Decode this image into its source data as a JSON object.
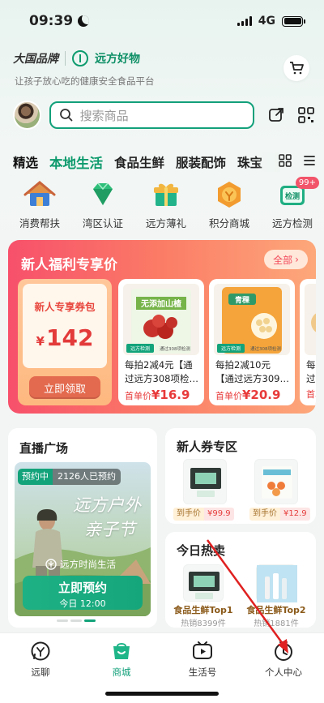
{
  "status_bar": {
    "time": "09:39",
    "network": "4G"
  },
  "header": {
    "brand_logo_text": "大国品牌",
    "brand_name": "远方好物",
    "slogan": "让孩子放心吃的健康安全食品平台"
  },
  "search": {
    "placeholder": "搜索商品"
  },
  "category_tabs": [
    "精选",
    "本地生活",
    "食品生鲜",
    "服装配饰",
    "珠宝"
  ],
  "active_tab": "本地生活",
  "quick_entries": [
    {
      "label": "消费帮扶",
      "icon": "house-icon"
    },
    {
      "label": "湾区认证",
      "icon": "gem-icon"
    },
    {
      "label": "远方薄礼",
      "icon": "gift-icon"
    },
    {
      "label": "积分商城",
      "icon": "coin-icon"
    },
    {
      "label": "远方检测",
      "icon": "test-icon",
      "badge": "99+",
      "icon_text": "检测"
    }
  ],
  "promo": {
    "title": "新人福利专享价",
    "all_label": "全部",
    "coupon": {
      "title": "新人专享券包",
      "currency": "¥",
      "amount": "142",
      "button": "立即领取"
    },
    "products": [
      {
        "line1": "每拍2减4元【通",
        "line2": "过远方308项检…",
        "price_label": "首单价",
        "price": "¥16.9",
        "img_text": "无添加山楂",
        "img_badge": "远方检测",
        "img_caption": "通过308项检测"
      },
      {
        "line1": "每拍2减10元",
        "line2": "【通过远方309…",
        "price_label": "首单价",
        "price": "¥20.9",
        "img_text": "青稞",
        "img_badge": "远方检测",
        "img_caption": "通过308项检测"
      },
      {
        "line1": "每拍",
        "line2": "过远",
        "price_label": "首单",
        "price": ""
      }
    ]
  },
  "live": {
    "title": "直播广场",
    "tag_status": "预约中",
    "tag_count": "2126人已预约",
    "script_line1": "远方户外",
    "script_line2": "亲子节",
    "brand": "远方时尚生活",
    "button_main": "立即预约",
    "button_sub": "今日 12:00"
  },
  "coupon_zone": {
    "title": "新人券专区",
    "items": [
      {
        "label": "到手价",
        "price": "¥99.9"
      },
      {
        "label": "到手价",
        "price": "¥12.9"
      }
    ]
  },
  "hot_today": {
    "title": "今日热卖",
    "items": [
      {
        "rank": "食品生鲜Top1",
        "sales": "热销8399件"
      },
      {
        "rank": "食品生鲜Top2",
        "sales": "热销1881件"
      }
    ]
  },
  "bottom_nav": [
    {
      "label": "远聊",
      "icon": "chat-icon"
    },
    {
      "label": "商城",
      "icon": "shop-icon",
      "active": true
    },
    {
      "label": "生活号",
      "icon": "video-icon"
    },
    {
      "label": "个人中心",
      "icon": "profile-icon"
    }
  ],
  "colors": {
    "accent": "#12a07a",
    "promo_start": "#f7506b",
    "price_red": "#e83a3a",
    "annotation_arrow": "#e02020"
  }
}
